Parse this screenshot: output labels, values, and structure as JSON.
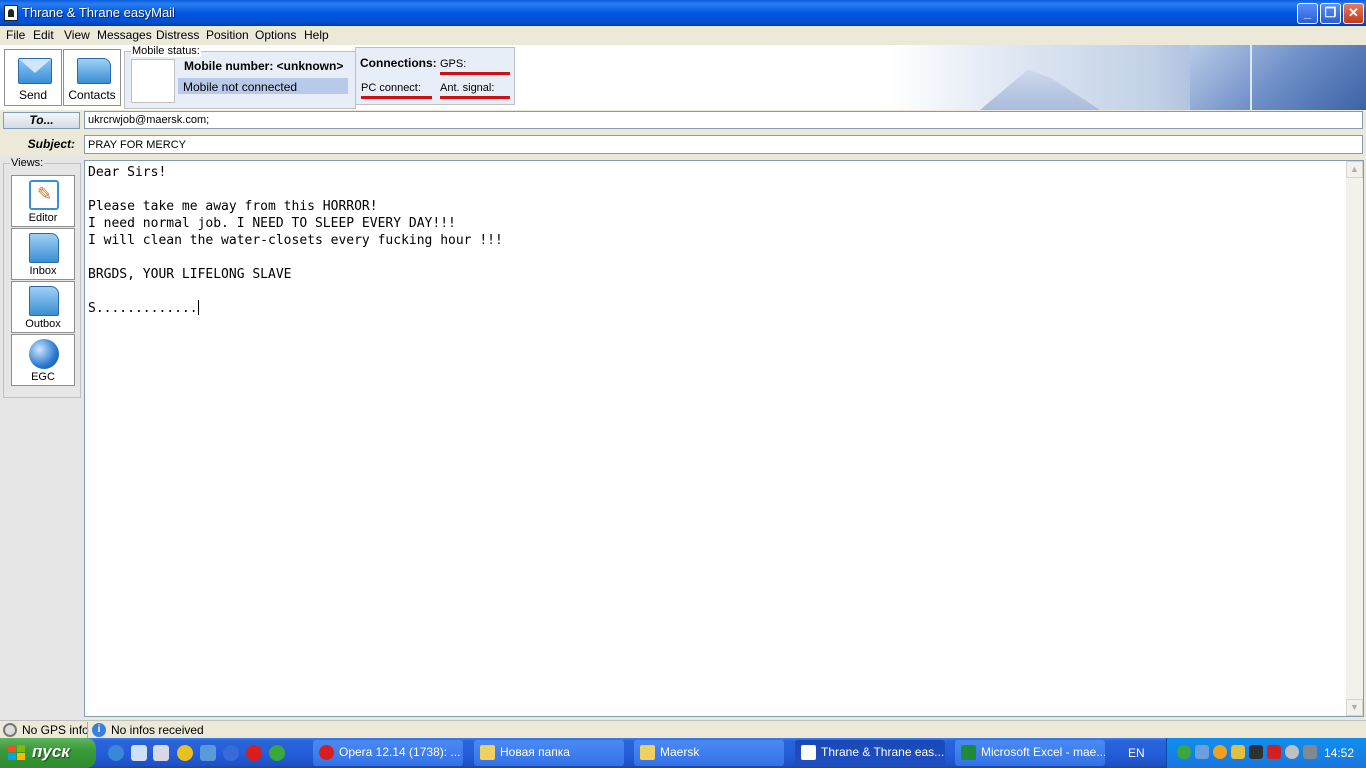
{
  "window": {
    "title": "Thrane & Thrane easyMail",
    "minimize": "_",
    "maximize": "❐",
    "close": "✕"
  },
  "menu": [
    "File",
    "Edit",
    "View",
    "Messages",
    "Distress",
    "Position",
    "Options",
    "Help"
  ],
  "toolbar": {
    "send_label": "Send",
    "contacts_label": "Contacts"
  },
  "mobile_status": {
    "legend": "Mobile status:",
    "number": "Mobile number: <unknown>",
    "connection": "Mobile not connected"
  },
  "connections": {
    "heading": "Connections:",
    "gps": "GPS:",
    "pc_connect": "PC connect:",
    "ant_signal": "Ant. signal:",
    "indicator_color": "#d01010"
  },
  "compose": {
    "to_button": "To...",
    "to_value": "ukrcrwjob@maersk.com;",
    "subject_label": "Subject:",
    "subject_value": "PRAY FOR MERCY",
    "body": "Dear Sirs!\n\nPlease take me away from this HORROR!\nI need normal job. I NEED TO SLEEP EVERY DAY!!!\nI will clean the water-closets every fucking hour !!!\n\nBRGDS, YOUR LIFELONG SLAVE\n\nS............."
  },
  "views": {
    "legend": "Views:",
    "items": [
      {
        "label": "Editor",
        "icon": "editor-icon"
      },
      {
        "label": "Inbox",
        "icon": "inbox-folder-icon"
      },
      {
        "label": "Outbox",
        "icon": "outbox-folder-icon"
      },
      {
        "label": "EGC",
        "icon": "globe-icon"
      }
    ]
  },
  "status": {
    "gps": "No GPS info",
    "info": "No infos received"
  },
  "taskbar": {
    "start_label": "пуск",
    "tasks": [
      {
        "label": "Opera 12.14 (1738): ...",
        "icon": "opera-icon"
      },
      {
        "label": "Новая папка",
        "icon": "folder-icon"
      },
      {
        "label": "Maersk",
        "icon": "folder-icon"
      },
      {
        "label": "Thrane & Thrane eas...",
        "icon": "easymail-icon"
      },
      {
        "label": "Microsoft Excel - mae...",
        "icon": "excel-icon"
      }
    ],
    "language": "EN",
    "clock": "14:52"
  }
}
